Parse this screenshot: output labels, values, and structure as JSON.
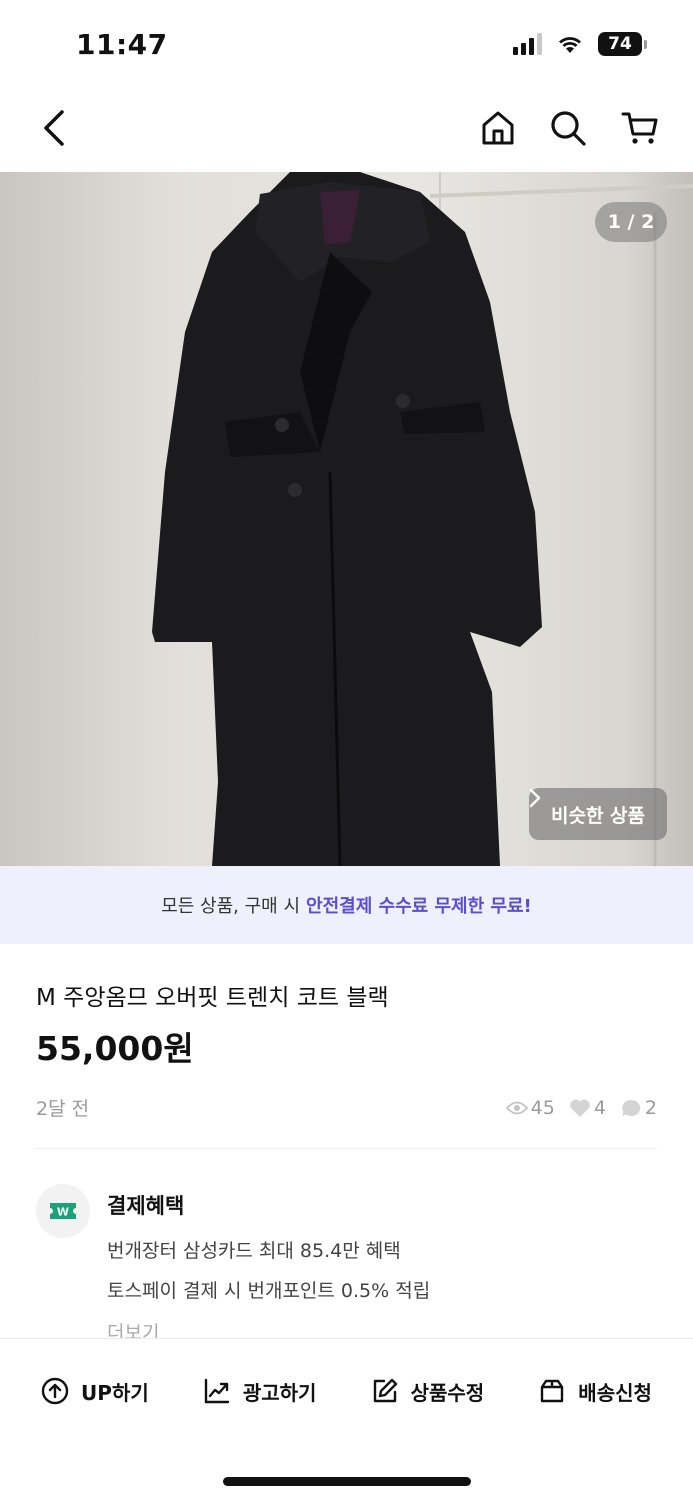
{
  "status_bar": {
    "time": "11:47",
    "battery": "74"
  },
  "header": {
    "back_icon": "chevron-left-icon",
    "home_icon": "home-icon",
    "search_icon": "search-icon",
    "cart_icon": "cart-icon"
  },
  "gallery": {
    "counter": "1 / 2",
    "similar_label": "비슷한 상품"
  },
  "promo": {
    "prefix": "모든 상품, 구매 시",
    "highlight": "안전결제 수수료 무제한 무료!",
    "highlight_color": "#5b4fd1"
  },
  "product": {
    "title": "M 주앙옴므 오버핏 트렌치 코트 블랙",
    "price": "55,000원",
    "posted": "2달 전",
    "views": "45",
    "likes": "4",
    "comments": "2"
  },
  "benefit": {
    "title": "결제혜택",
    "lines": [
      "번개장터 삼성카드 최대 85.4만 혜택",
      "토스페이 결제 시 번개포인트 0.5% 적립"
    ],
    "more": "더보기",
    "icon_color": "#1aa37a"
  },
  "actions": [
    {
      "label": "UP하기",
      "icon": "arrow-up-circle-icon"
    },
    {
      "label": "광고하기",
      "icon": "trending-chart-icon"
    },
    {
      "label": "상품수정",
      "icon": "edit-icon"
    },
    {
      "label": "배송신청",
      "icon": "box-icon"
    }
  ]
}
